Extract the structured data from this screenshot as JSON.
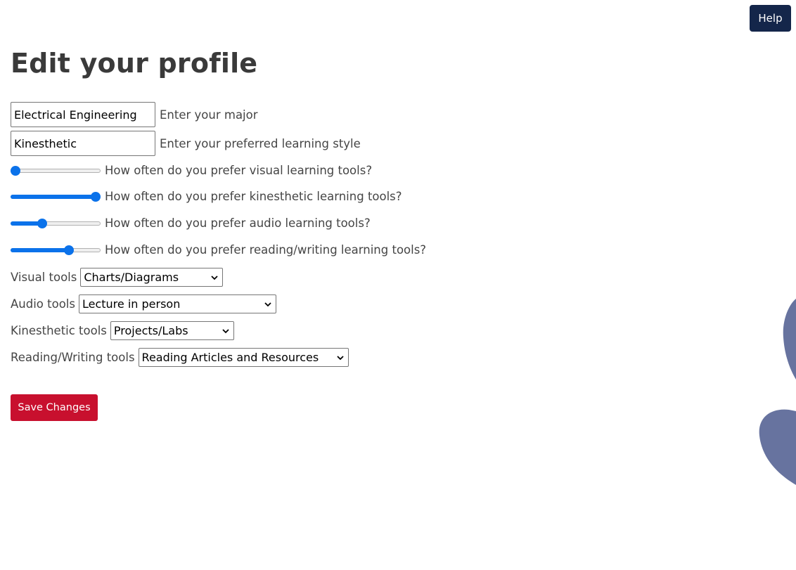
{
  "header": {
    "help_label": "Help"
  },
  "page": {
    "title": "Edit your profile"
  },
  "form": {
    "major": {
      "value": "Electrical Engineering",
      "label": "Enter your major"
    },
    "learning_style": {
      "value": "Kinesthetic",
      "label": "Enter your preferred learning style"
    },
    "sliders": [
      {
        "label": "How often do you prefer visual learning tools?",
        "value": 0.0
      },
      {
        "label": "How often do you prefer kinesthetic learning tools?",
        "value": 1.0
      },
      {
        "label": "How often do you prefer audio learning tools?",
        "value": 0.33
      },
      {
        "label": "How often do you prefer reading/writing learning tools?",
        "value": 0.67
      }
    ],
    "selects": [
      {
        "label": "Visual tools",
        "selected": "Charts/Diagrams"
      },
      {
        "label": "Audio tools",
        "selected": "Lecture in person"
      },
      {
        "label": "Kinesthetic tools",
        "selected": "Projects/Labs"
      },
      {
        "label": "Reading/Writing tools",
        "selected": "Reading Articles and Resources"
      }
    ],
    "save_label": "Save Changes"
  },
  "colors": {
    "help_bg": "#14264a",
    "save_bg": "#c8102e",
    "slider_accent": "#0b72ea",
    "decoration": "#67739f"
  }
}
